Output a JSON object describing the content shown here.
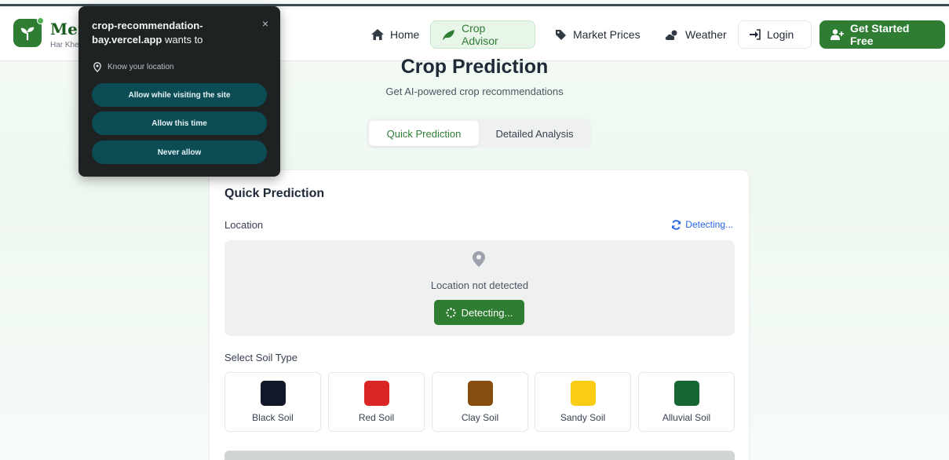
{
  "header": {
    "brand": "Mer",
    "brand_sub": "Har Khe",
    "nav": {
      "home": "Home",
      "crop_advisor": "Crop Advisor",
      "market_prices": "Market Prices",
      "weather": "Weather",
      "login": "Login",
      "get_started": "Get Started Free"
    }
  },
  "page": {
    "title": "Crop Prediction",
    "subtitle": "Get AI-powered crop recommendations",
    "tabs": [
      "Quick Prediction",
      "Detailed Analysis"
    ]
  },
  "card": {
    "title": "Quick Prediction",
    "location_label": "Location",
    "detecting_link": "Detecting...",
    "location_status": "Location not detected",
    "detect_button": "Detecting...",
    "soil_label": "Select Soil Type",
    "soils": [
      {
        "name": "Black Soil",
        "color": "#111827"
      },
      {
        "name": "Red Soil",
        "color": "#dc2626"
      },
      {
        "name": "Clay Soil",
        "color": "#854d0e"
      },
      {
        "name": "Sandy Soil",
        "color": "#facc15"
      },
      {
        "name": "Alluvial Soil",
        "color": "#166534"
      }
    ]
  },
  "popup": {
    "site": "crop-recommendation-bay.vercel.app",
    "wants": "wants to",
    "close": "×",
    "permission": "Know your location",
    "buttons": [
      "Allow while visiting the site",
      "Allow this time",
      "Never allow"
    ]
  }
}
